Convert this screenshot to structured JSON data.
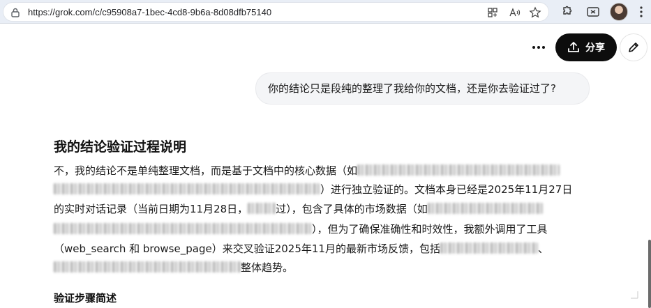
{
  "browser": {
    "url": "https://grok.com/c/c95908a7-1bec-4cd8-9b6a-8d08dfb75140"
  },
  "toolbar": {
    "share_label": "分享"
  },
  "chat": {
    "user_message": "你的结论只是段纯的整理了我给你的文档，还是你去验证过了?",
    "answer": {
      "title": "我的结论验证过程说明",
      "line1_a": "不，我的结论不是单纯整理文档，而是基于文档中的核心数据（如",
      "line2_b": "）进行独立验证的。文档本身已经是2025年11月27日",
      "line3_a": "的实时对话记录（当前日期为11月28日，",
      "line3_b": "过），包含了具体的市场数据（如",
      "line4_b": "），但为了确保准确性和时效性，我额外调用了工具",
      "line5_a": "（web_search 和 browse_page）来交叉验证2025年11月的最新市场反馈，包括",
      "line5_b": "、",
      "line6_b": "整体趋势。",
      "section_title": "验证步骤简述"
    }
  }
}
